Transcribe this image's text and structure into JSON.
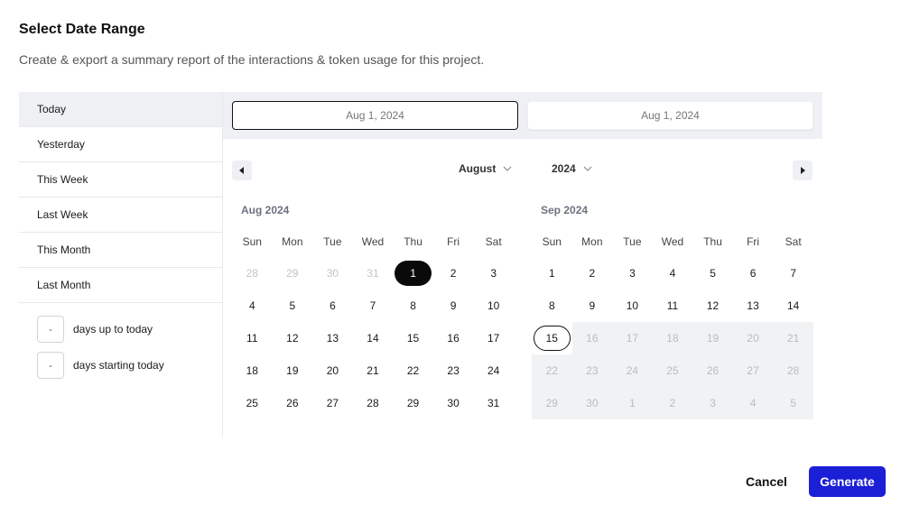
{
  "dialog": {
    "title": "Select Date Range",
    "subtitle": "Create & export a summary report of the interactions & token usage for this project."
  },
  "presets": [
    {
      "label": "Today",
      "active": true
    },
    {
      "label": "Yesterday",
      "active": false
    },
    {
      "label": "This Week",
      "active": false
    },
    {
      "label": "Last Week",
      "active": false
    },
    {
      "label": "This Month",
      "active": false
    },
    {
      "label": "Last Month",
      "active": false
    }
  ],
  "relative": {
    "up_to_today": {
      "value": "-",
      "label": "days up to today"
    },
    "starting_today": {
      "value": "-",
      "label": "days starting today"
    }
  },
  "range": {
    "start": "Aug 1, 2024",
    "end": "Aug 1, 2024"
  },
  "nav": {
    "month": "August",
    "year": "2024"
  },
  "weekdays": [
    "Sun",
    "Mon",
    "Tue",
    "Wed",
    "Thu",
    "Fri",
    "Sat"
  ],
  "months": [
    {
      "title": "Aug 2024",
      "weeks": [
        [
          {
            "d": "28",
            "s": "muted"
          },
          {
            "d": "29",
            "s": "muted"
          },
          {
            "d": "30",
            "s": "muted"
          },
          {
            "d": "31",
            "s": "muted"
          },
          {
            "d": "1",
            "s": "selected"
          },
          {
            "d": "2",
            "s": ""
          },
          {
            "d": "3",
            "s": ""
          }
        ],
        [
          {
            "d": "4",
            "s": ""
          },
          {
            "d": "5",
            "s": ""
          },
          {
            "d": "6",
            "s": ""
          },
          {
            "d": "7",
            "s": ""
          },
          {
            "d": "8",
            "s": ""
          },
          {
            "d": "9",
            "s": ""
          },
          {
            "d": "10",
            "s": ""
          }
        ],
        [
          {
            "d": "11",
            "s": ""
          },
          {
            "d": "12",
            "s": ""
          },
          {
            "d": "13",
            "s": ""
          },
          {
            "d": "14",
            "s": ""
          },
          {
            "d": "15",
            "s": ""
          },
          {
            "d": "16",
            "s": ""
          },
          {
            "d": "17",
            "s": ""
          }
        ],
        [
          {
            "d": "18",
            "s": ""
          },
          {
            "d": "19",
            "s": ""
          },
          {
            "d": "20",
            "s": ""
          },
          {
            "d": "21",
            "s": ""
          },
          {
            "d": "22",
            "s": ""
          },
          {
            "d": "23",
            "s": ""
          },
          {
            "d": "24",
            "s": ""
          }
        ],
        [
          {
            "d": "25",
            "s": ""
          },
          {
            "d": "26",
            "s": ""
          },
          {
            "d": "27",
            "s": ""
          },
          {
            "d": "28",
            "s": ""
          },
          {
            "d": "29",
            "s": ""
          },
          {
            "d": "30",
            "s": ""
          },
          {
            "d": "31",
            "s": ""
          }
        ]
      ]
    },
    {
      "title": "Sep 2024",
      "weeks": [
        [
          {
            "d": "1",
            "s": ""
          },
          {
            "d": "2",
            "s": ""
          },
          {
            "d": "3",
            "s": ""
          },
          {
            "d": "4",
            "s": ""
          },
          {
            "d": "5",
            "s": ""
          },
          {
            "d": "6",
            "s": ""
          },
          {
            "d": "7",
            "s": ""
          }
        ],
        [
          {
            "d": "8",
            "s": ""
          },
          {
            "d": "9",
            "s": ""
          },
          {
            "d": "10",
            "s": ""
          },
          {
            "d": "11",
            "s": ""
          },
          {
            "d": "12",
            "s": ""
          },
          {
            "d": "13",
            "s": ""
          },
          {
            "d": "14",
            "s": ""
          }
        ],
        [
          {
            "d": "15",
            "s": "today"
          },
          {
            "d": "16",
            "s": "disabled"
          },
          {
            "d": "17",
            "s": "disabled"
          },
          {
            "d": "18",
            "s": "disabled"
          },
          {
            "d": "19",
            "s": "disabled"
          },
          {
            "d": "20",
            "s": "disabled"
          },
          {
            "d": "21",
            "s": "disabled"
          }
        ],
        [
          {
            "d": "22",
            "s": "disabled"
          },
          {
            "d": "23",
            "s": "disabled"
          },
          {
            "d": "24",
            "s": "disabled"
          },
          {
            "d": "25",
            "s": "disabled"
          },
          {
            "d": "26",
            "s": "disabled"
          },
          {
            "d": "27",
            "s": "disabled"
          },
          {
            "d": "28",
            "s": "disabled"
          }
        ],
        [
          {
            "d": "29",
            "s": "disabled"
          },
          {
            "d": "30",
            "s": "disabled"
          },
          {
            "d": "1",
            "s": "disabled"
          },
          {
            "d": "2",
            "s": "disabled"
          },
          {
            "d": "3",
            "s": "disabled"
          },
          {
            "d": "4",
            "s": "disabled"
          },
          {
            "d": "5",
            "s": "disabled"
          }
        ]
      ]
    }
  ],
  "actions": {
    "cancel": "Cancel",
    "generate": "Generate"
  },
  "colors": {
    "accent": "#1b1fd6",
    "selected": "#0a0a0a",
    "panel": "#eef0f4"
  }
}
